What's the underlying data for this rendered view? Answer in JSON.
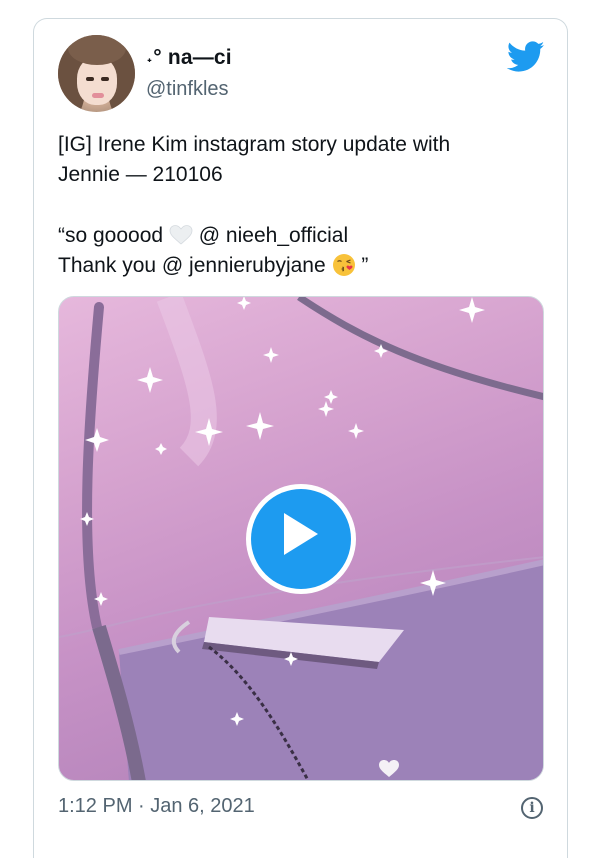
{
  "tweet": {
    "display_name": "˖° na—ci",
    "handle": "@tinfkles",
    "text_lines": [
      "[IG] Irene Kim instagram story update with",
      "Jennie — 210106"
    ],
    "quote_line1_before": "“so gooood",
    "quote_line1_after": "@ nieeh_official",
    "quote_line2_before": "Thank you @ jennierubyjane",
    "quote_line2_after": "”",
    "timestamp": "1:12 PM · Jan 6, 2021",
    "info_glyph": "i"
  },
  "icons": {
    "brand": "twitter-bird-icon",
    "heart": "white-heart-icon",
    "kiss": "face-blowing-kiss-icon",
    "play": "play-icon",
    "info": "info-icon"
  },
  "colors": {
    "accent": "#1d9bf0",
    "secondary_text": "#536471",
    "media_tint": "#c792c6"
  }
}
